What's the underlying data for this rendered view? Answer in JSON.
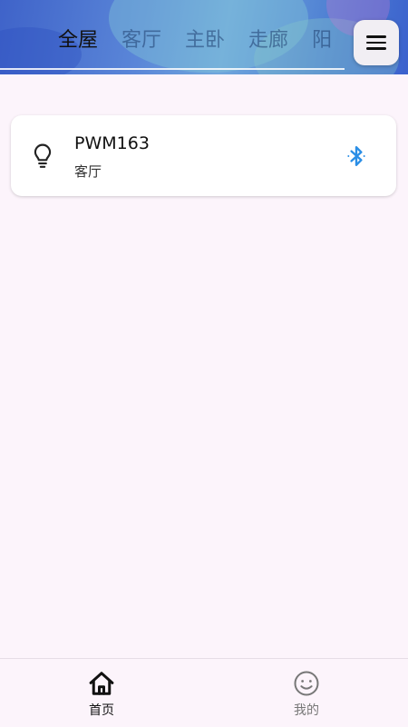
{
  "header": {
    "tabs": [
      "全屋",
      "客厅",
      "主卧",
      "走廊",
      "阳"
    ],
    "active_tab": 0,
    "menu_icon": "hamburger-menu-icon"
  },
  "devices": [
    {
      "name": "PWM163",
      "room": "客厅",
      "icon": "lightbulb-icon",
      "connection_icon": "bluetooth-icon",
      "connection_color": "#2a8ee6"
    }
  ],
  "bottom_nav": {
    "items": [
      {
        "label": "首页",
        "icon": "home-icon",
        "active": true
      },
      {
        "label": "我的",
        "icon": "smiley-icon",
        "active": false
      }
    ]
  },
  "colors": {
    "background": "#fcf4fb",
    "header_primary": "#3f63c9",
    "accent_bluetooth": "#2a8ee6"
  }
}
